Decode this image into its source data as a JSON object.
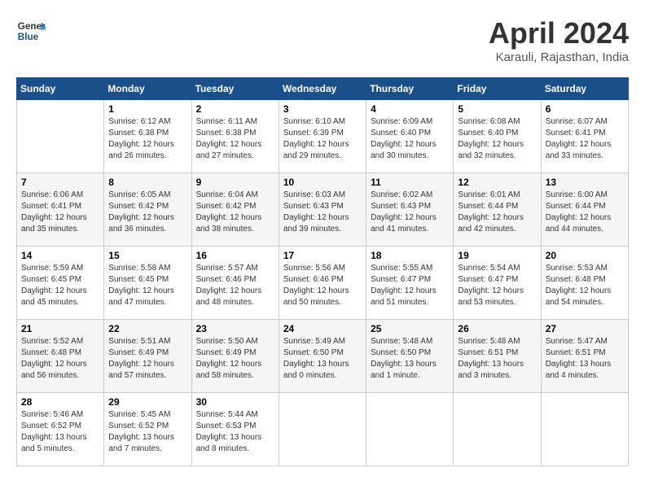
{
  "header": {
    "logo_line1": "General",
    "logo_line2": "Blue",
    "month": "April 2024",
    "location": "Karauli, Rajasthan, India"
  },
  "weekdays": [
    "Sunday",
    "Monday",
    "Tuesday",
    "Wednesday",
    "Thursday",
    "Friday",
    "Saturday"
  ],
  "weeks": [
    [
      {
        "num": "",
        "info": ""
      },
      {
        "num": "1",
        "info": "Sunrise: 6:12 AM\nSunset: 6:38 PM\nDaylight: 12 hours\nand 26 minutes."
      },
      {
        "num": "2",
        "info": "Sunrise: 6:11 AM\nSunset: 6:38 PM\nDaylight: 12 hours\nand 27 minutes."
      },
      {
        "num": "3",
        "info": "Sunrise: 6:10 AM\nSunset: 6:39 PM\nDaylight: 12 hours\nand 29 minutes."
      },
      {
        "num": "4",
        "info": "Sunrise: 6:09 AM\nSunset: 6:40 PM\nDaylight: 12 hours\nand 30 minutes."
      },
      {
        "num": "5",
        "info": "Sunrise: 6:08 AM\nSunset: 6:40 PM\nDaylight: 12 hours\nand 32 minutes."
      },
      {
        "num": "6",
        "info": "Sunrise: 6:07 AM\nSunset: 6:41 PM\nDaylight: 12 hours\nand 33 minutes."
      }
    ],
    [
      {
        "num": "7",
        "info": "Sunrise: 6:06 AM\nSunset: 6:41 PM\nDaylight: 12 hours\nand 35 minutes."
      },
      {
        "num": "8",
        "info": "Sunrise: 6:05 AM\nSunset: 6:42 PM\nDaylight: 12 hours\nand 36 minutes."
      },
      {
        "num": "9",
        "info": "Sunrise: 6:04 AM\nSunset: 6:42 PM\nDaylight: 12 hours\nand 38 minutes."
      },
      {
        "num": "10",
        "info": "Sunrise: 6:03 AM\nSunset: 6:43 PM\nDaylight: 12 hours\nand 39 minutes."
      },
      {
        "num": "11",
        "info": "Sunrise: 6:02 AM\nSunset: 6:43 PM\nDaylight: 12 hours\nand 41 minutes."
      },
      {
        "num": "12",
        "info": "Sunrise: 6:01 AM\nSunset: 6:44 PM\nDaylight: 12 hours\nand 42 minutes."
      },
      {
        "num": "13",
        "info": "Sunrise: 6:00 AM\nSunset: 6:44 PM\nDaylight: 12 hours\nand 44 minutes."
      }
    ],
    [
      {
        "num": "14",
        "info": "Sunrise: 5:59 AM\nSunset: 6:45 PM\nDaylight: 12 hours\nand 45 minutes."
      },
      {
        "num": "15",
        "info": "Sunrise: 5:58 AM\nSunset: 6:45 PM\nDaylight: 12 hours\nand 47 minutes."
      },
      {
        "num": "16",
        "info": "Sunrise: 5:57 AM\nSunset: 6:46 PM\nDaylight: 12 hours\nand 48 minutes."
      },
      {
        "num": "17",
        "info": "Sunrise: 5:56 AM\nSunset: 6:46 PM\nDaylight: 12 hours\nand 50 minutes."
      },
      {
        "num": "18",
        "info": "Sunrise: 5:55 AM\nSunset: 6:47 PM\nDaylight: 12 hours\nand 51 minutes."
      },
      {
        "num": "19",
        "info": "Sunrise: 5:54 AM\nSunset: 6:47 PM\nDaylight: 12 hours\nand 53 minutes."
      },
      {
        "num": "20",
        "info": "Sunrise: 5:53 AM\nSunset: 6:48 PM\nDaylight: 12 hours\nand 54 minutes."
      }
    ],
    [
      {
        "num": "21",
        "info": "Sunrise: 5:52 AM\nSunset: 6:48 PM\nDaylight: 12 hours\nand 56 minutes."
      },
      {
        "num": "22",
        "info": "Sunrise: 5:51 AM\nSunset: 6:49 PM\nDaylight: 12 hours\nand 57 minutes."
      },
      {
        "num": "23",
        "info": "Sunrise: 5:50 AM\nSunset: 6:49 PM\nDaylight: 12 hours\nand 58 minutes."
      },
      {
        "num": "24",
        "info": "Sunrise: 5:49 AM\nSunset: 6:50 PM\nDaylight: 13 hours\nand 0 minutes."
      },
      {
        "num": "25",
        "info": "Sunrise: 5:48 AM\nSunset: 6:50 PM\nDaylight: 13 hours\nand 1 minute."
      },
      {
        "num": "26",
        "info": "Sunrise: 5:48 AM\nSunset: 6:51 PM\nDaylight: 13 hours\nand 3 minutes."
      },
      {
        "num": "27",
        "info": "Sunrise: 5:47 AM\nSunset: 6:51 PM\nDaylight: 13 hours\nand 4 minutes."
      }
    ],
    [
      {
        "num": "28",
        "info": "Sunrise: 5:46 AM\nSunset: 6:52 PM\nDaylight: 13 hours\nand 5 minutes."
      },
      {
        "num": "29",
        "info": "Sunrise: 5:45 AM\nSunset: 6:52 PM\nDaylight: 13 hours\nand 7 minutes."
      },
      {
        "num": "30",
        "info": "Sunrise: 5:44 AM\nSunset: 6:53 PM\nDaylight: 13 hours\nand 8 minutes."
      },
      {
        "num": "",
        "info": ""
      },
      {
        "num": "",
        "info": ""
      },
      {
        "num": "",
        "info": ""
      },
      {
        "num": "",
        "info": ""
      }
    ]
  ]
}
